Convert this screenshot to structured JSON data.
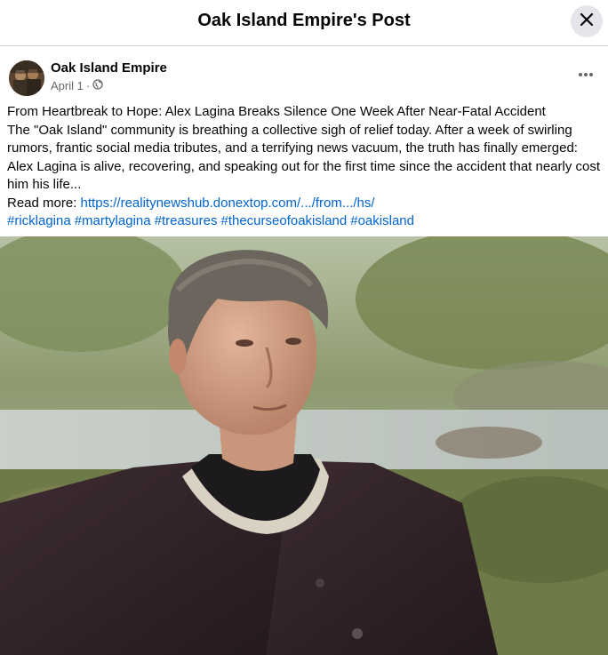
{
  "dialog": {
    "title": "Oak Island Empire's Post"
  },
  "icons": {
    "close": "close-icon",
    "more": "more-horizontal-icon",
    "audience": "globe-icon"
  },
  "post": {
    "page_name": "Oak Island Empire",
    "date": "April 1",
    "separator": "·",
    "headline": "From Heartbreak to Hope: Alex Lagina Breaks Silence One Week After Near-Fatal Accident",
    "body": "The \"Oak Island\" community is breathing a collective sigh of relief today. After a week of swirling rumors, frantic social media tributes, and a terrifying news vacuum, the truth has finally emerged: Alex Lagina is alive, recovering, and speaking out for the first time since the accident that nearly cost him his life...",
    "read_more_label": "Read more: ",
    "link": "https://realitynewshub.donextop.com/.../from.../hs/",
    "hashtags": [
      "#ricklagina",
      "#martylagina",
      "#treasures",
      "#thecurseofoakisland",
      "#oakisland"
    ]
  },
  "colors": {
    "link": "#0064d1",
    "secondary_text": "#65676b",
    "divider": "#ced0d4",
    "close_button_bg": "#e4e6eb"
  }
}
